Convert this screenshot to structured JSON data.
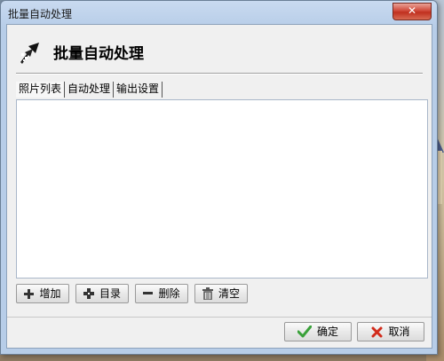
{
  "window": {
    "title": "批量自动处理",
    "close_label": "✕"
  },
  "header": {
    "title": "批量自动处理",
    "icon": "hand-arrow-icon"
  },
  "tabs": [
    {
      "label": "照片列表",
      "active": true
    },
    {
      "label": "自动处理",
      "active": false
    },
    {
      "label": "输出设置",
      "active": false
    }
  ],
  "toolbar": {
    "add_label": "增加",
    "folder_label": "目录",
    "delete_label": "删除",
    "clear_label": "清空"
  },
  "footer": {
    "ok_label": "确定",
    "cancel_label": "取消"
  },
  "colors": {
    "ok_check": "#3aa13a",
    "cancel_x": "#d22b1b",
    "close_button": "#c0301f"
  }
}
